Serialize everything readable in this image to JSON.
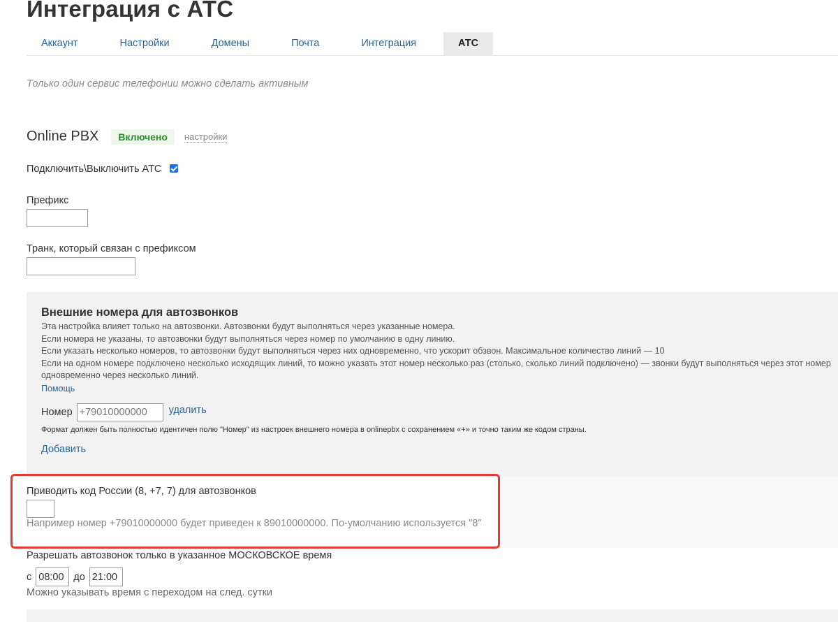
{
  "page": {
    "title": "Интеграция с АТС"
  },
  "tabs": [
    {
      "label": "Аккаунт"
    },
    {
      "label": "Настройки"
    },
    {
      "label": "Домены"
    },
    {
      "label": "Почта"
    },
    {
      "label": "Интеграция"
    },
    {
      "label": "АТС",
      "active": true
    }
  ],
  "note": "Только один сервис телефонии можно сделать активным",
  "service": {
    "name": "Online PBX",
    "status": "Включено",
    "settings_link": "настройки",
    "toggle_label": "Подключить\\Выключить АТС",
    "toggle_checked": true
  },
  "prefix": {
    "label": "Префикс",
    "value": ""
  },
  "trunk": {
    "label": "Транк, который связан с префиксом",
    "value": ""
  },
  "external_numbers": {
    "title": "Внешние номера для автозвонков",
    "description": [
      "Эта настройка влияет только на автозвонки. Автозвонки будут выполняться через указанные номера.",
      "Если номера не указаны, то автозвонки будут выполняться через номер по умолчанию в одну линию.",
      "Если указать несколько номеров, то автозвонки будут выполняться через них одновременно, что ускорит обзвон. Максимальное количество линий — 10",
      "Если на одном номере подключено несколько исходящих линий, то можно указать этот номер несколько раз (столько, сколько линий подключено) — звонки будут выполняться через этот номер",
      "одновременно через несколько линий."
    ],
    "help_link": "Помощь",
    "number_label": "Номер",
    "number_placeholder": "+79010000000",
    "delete_link": "удалить",
    "format_note": "Формат должен быть полностью идентичен полю \"Номер\" из настроек внешнего номера в onlinepbx с сохранением «+» и точно таким же кодом страны.",
    "add_link": "Добавить"
  },
  "russia_code": {
    "label": "Приводить код России (8, +7, 7) для автозвонков",
    "value": "",
    "hint": "Например номер +79010000000 будет приведен к 89010000000. По-умолчанию используется \"8\""
  },
  "time_window": {
    "label": "Разрешать автозвонок только в указанное МОСКОВСКОЕ время",
    "from_label": "с",
    "from_value": "08:00",
    "to_label": "до",
    "to_value": "21:00",
    "hint": "Можно указывать время с переходом на след. сутки"
  },
  "colors": {
    "link": "#2a6496",
    "status_green": "#2f8a2f",
    "highlight_red": "#e53935",
    "checkbox_blue": "#1a73e8"
  }
}
